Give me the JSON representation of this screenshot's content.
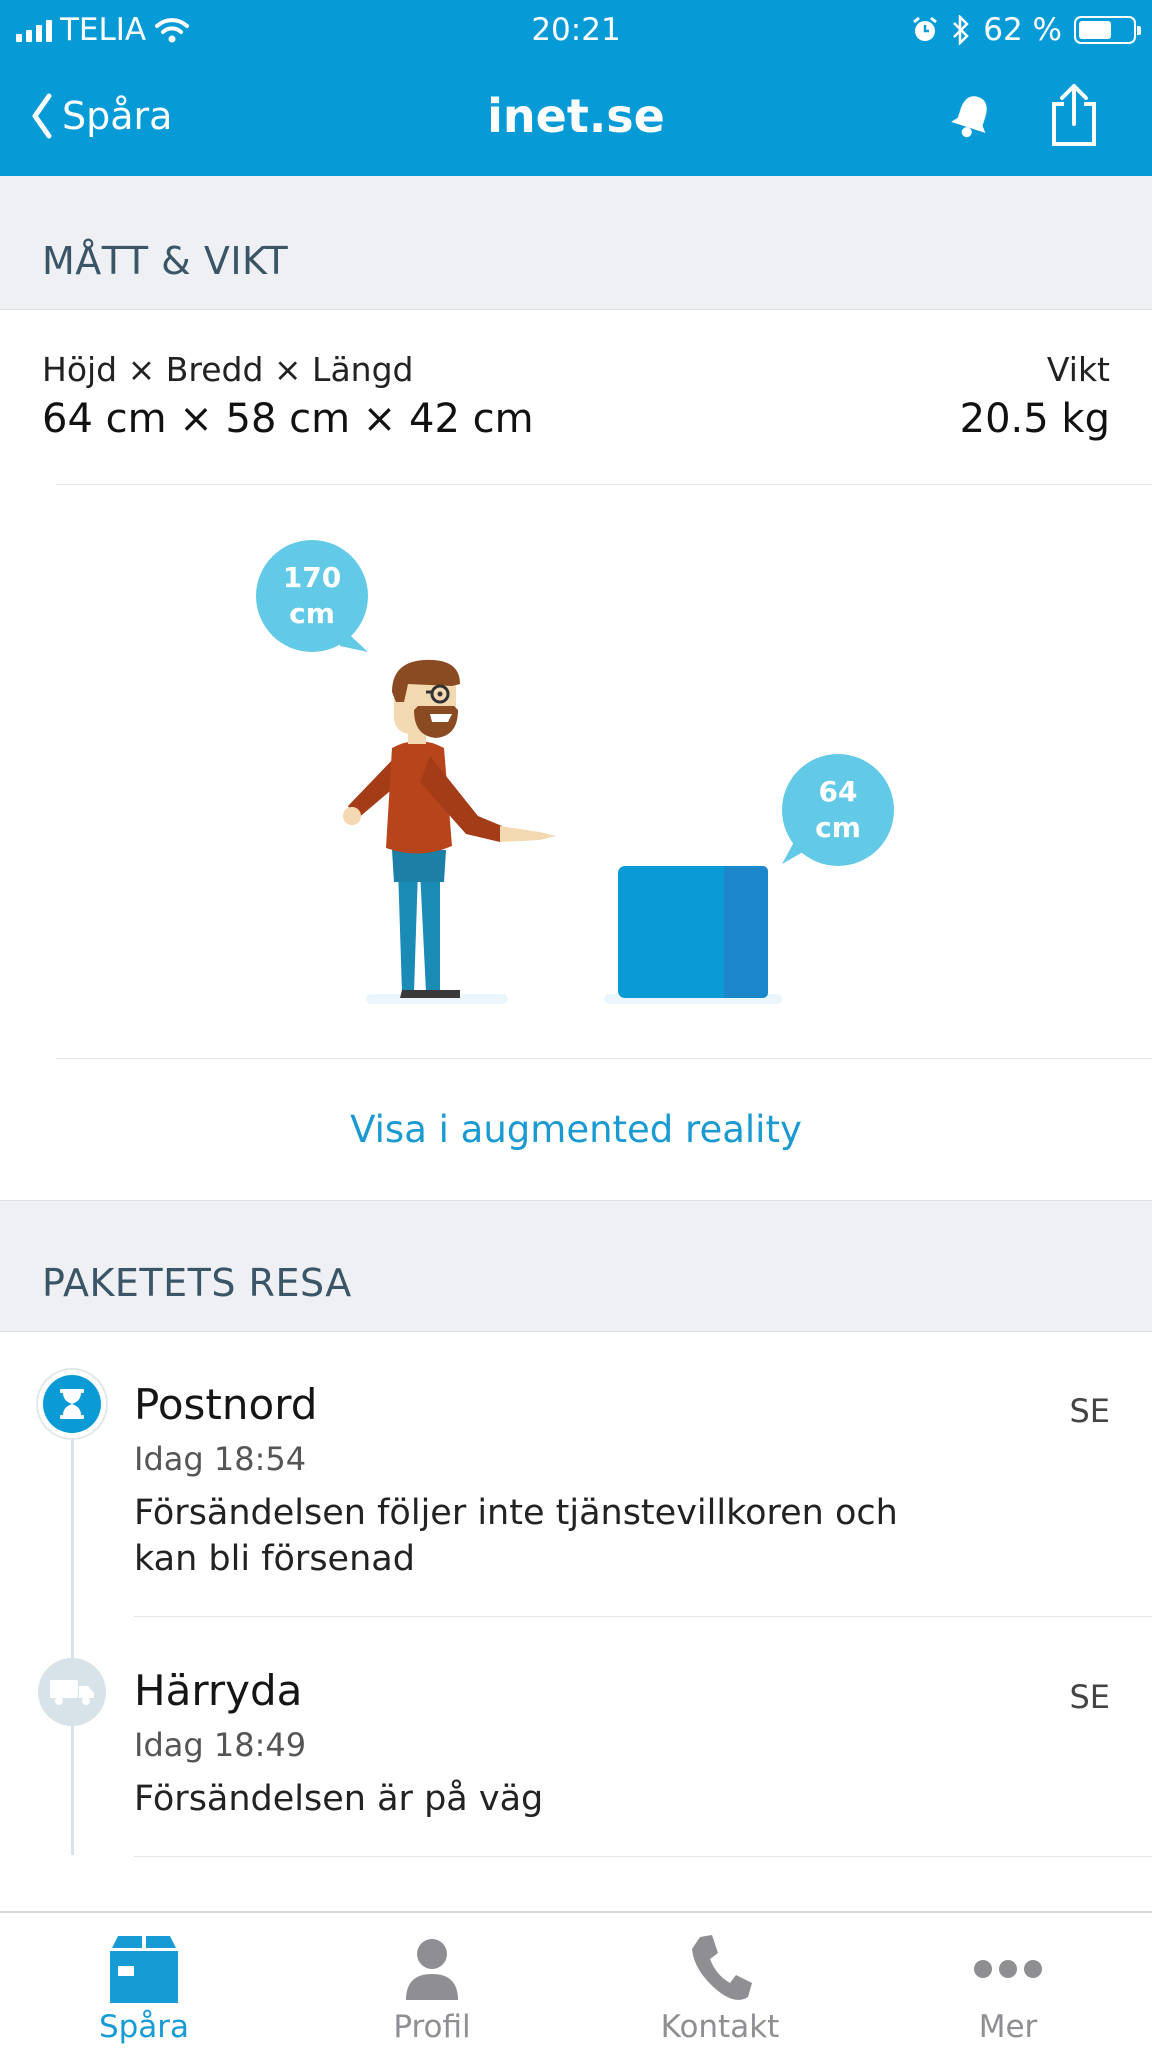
{
  "status_bar": {
    "carrier": "TELIA",
    "time": "20:21",
    "battery": "62 %",
    "battery_level": 0.62
  },
  "nav": {
    "back_label": "Spåra",
    "title": "inet.se"
  },
  "measurements": {
    "section_title": "MÅTT & VIKT",
    "dims_label": "Höjd × Bredd × Längd",
    "dims_value": "64 cm × 58 cm × 42 cm",
    "weight_label": "Vikt",
    "weight_value": "20.5 kg"
  },
  "illustration": {
    "person_bubble": [
      "170",
      "cm"
    ],
    "package_bubble": [
      "64",
      "cm"
    ]
  },
  "ar_link": "Visa i augmented reality",
  "journey": {
    "section_title": "PAKETETS RESA",
    "events": [
      {
        "place": "Postnord",
        "country": "SE",
        "time": "Idag 18:54",
        "message": "Försändelsen följer inte tjänstevillkoren och kan bli försenad",
        "icon": "hourglass-icon"
      },
      {
        "place": "Härryda",
        "country": "SE",
        "time": "Idag 18:49",
        "message": "Försändelsen är på väg",
        "icon": "truck-icon"
      }
    ]
  },
  "tabs": [
    {
      "label": "Spåra",
      "icon": "package-icon",
      "active": true
    },
    {
      "label": "Profil",
      "icon": "person-icon",
      "active": false
    },
    {
      "label": "Kontakt",
      "icon": "phone-icon",
      "active": false
    },
    {
      "label": "Mer",
      "icon": "more-icon",
      "active": false
    }
  ],
  "colors": {
    "brand_blue": "#069bd6",
    "link_blue": "#1a9ad0",
    "bubble_blue": "#62c9e6",
    "section_bg": "#eef0f4",
    "tab_inactive": "#8e8e93"
  }
}
